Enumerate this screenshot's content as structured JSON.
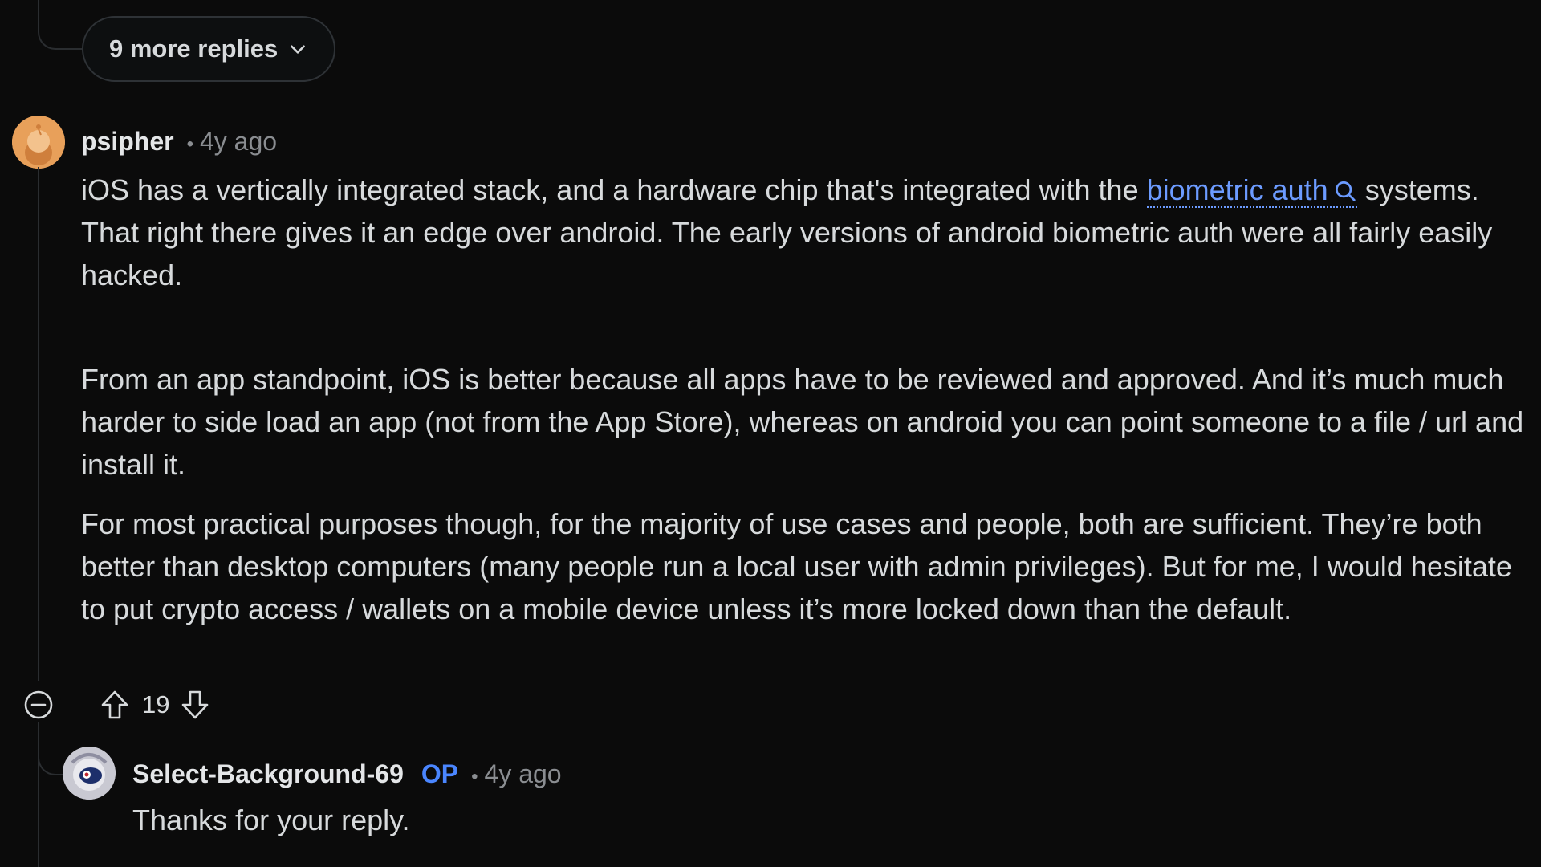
{
  "thread": {
    "more_replies_label": "9 more replies"
  },
  "comment": {
    "author": "psipher",
    "separator": "•",
    "time": "4y ago",
    "p1_a": "iOS has a vertically integrated stack, and a hardware chip that's integrated with the ",
    "link_text": "biometric auth",
    "p1_b": " systems.",
    "p1_c": "That right there gives it an edge over android. The early versions of android biometric auth were all fairly easily hacked.",
    "p2": "From an app standpoint, iOS is better because all apps have to be reviewed and approved. And it’s much much harder to side load an app (not from the App Store), whereas on android you can point someone to a file / url and install it.",
    "p3": "For most practical purposes though, for the majority of use cases and people, both are sufficient. They’re both better than desktop computers (many people run a local user with admin privileges). But for me, I would hesitate to put crypto access / wallets on a mobile device unless it’s more locked down than the default.",
    "score": "19"
  },
  "reply": {
    "author": "Select-Background-69",
    "op_badge": "OP",
    "separator": "•",
    "time": "4y ago",
    "text": "Thanks for your reply."
  },
  "icons": {
    "more_replies": "chevron-down-icon",
    "link": "search-icon",
    "collapse": "collapse-icon",
    "upvote": "upvote-icon",
    "downvote": "downvote-icon"
  },
  "colors": {
    "background": "#0b0b0b",
    "text": "#d7dadc",
    "muted": "#8a8d91",
    "link": "#6c9bff",
    "op": "#4a86ff"
  }
}
